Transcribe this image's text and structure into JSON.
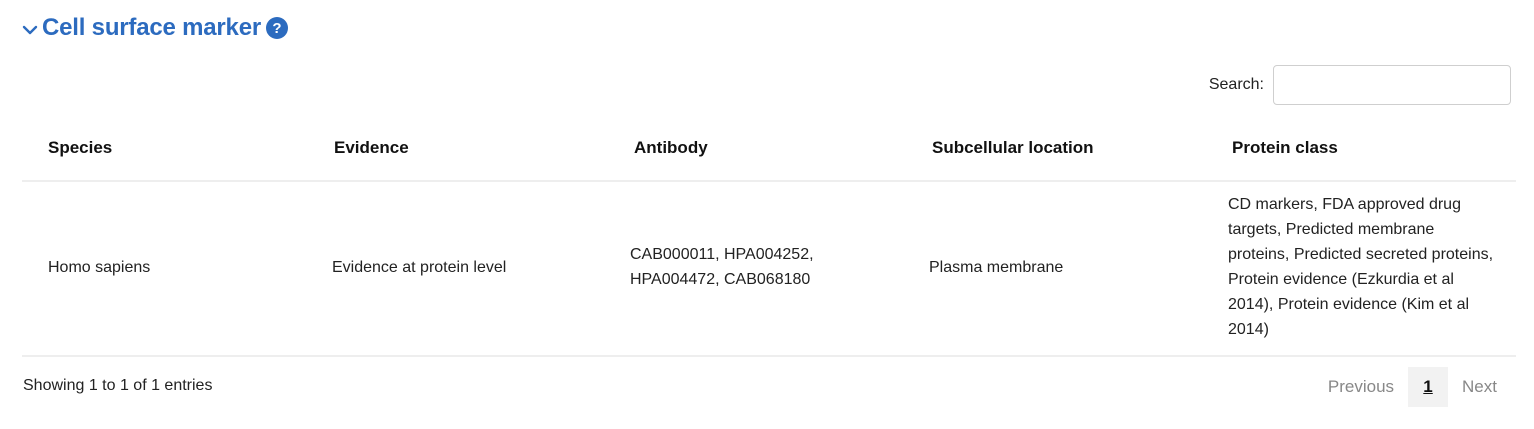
{
  "section": {
    "title": "Cell surface marker",
    "help_glyph": "?"
  },
  "search": {
    "label": "Search:",
    "value": "",
    "placeholder": ""
  },
  "table": {
    "columns": [
      "Species",
      "Evidence",
      "Antibody",
      "Subcellular location",
      "Protein class"
    ],
    "rows": [
      {
        "species": "Homo sapiens",
        "evidence": "Evidence at protein level",
        "antibody": "CAB000011, HPA004252, HPA004472, CAB068180",
        "location": "Plasma membrane",
        "protein_class": "CD markers, FDA approved drug targets, Predicted membrane proteins, Predicted secreted proteins, Protein evidence (Ezkurdia et al 2014), Protein evidence (Kim et al 2014)"
      }
    ]
  },
  "footer": {
    "info": "Showing 1 to 1 of 1 entries"
  },
  "pagination": {
    "previous": "Previous",
    "current_page": "1",
    "next": "Next"
  },
  "colors": {
    "accent": "#2c6bbf",
    "border": "#eeeeee",
    "muted": "#888888"
  }
}
